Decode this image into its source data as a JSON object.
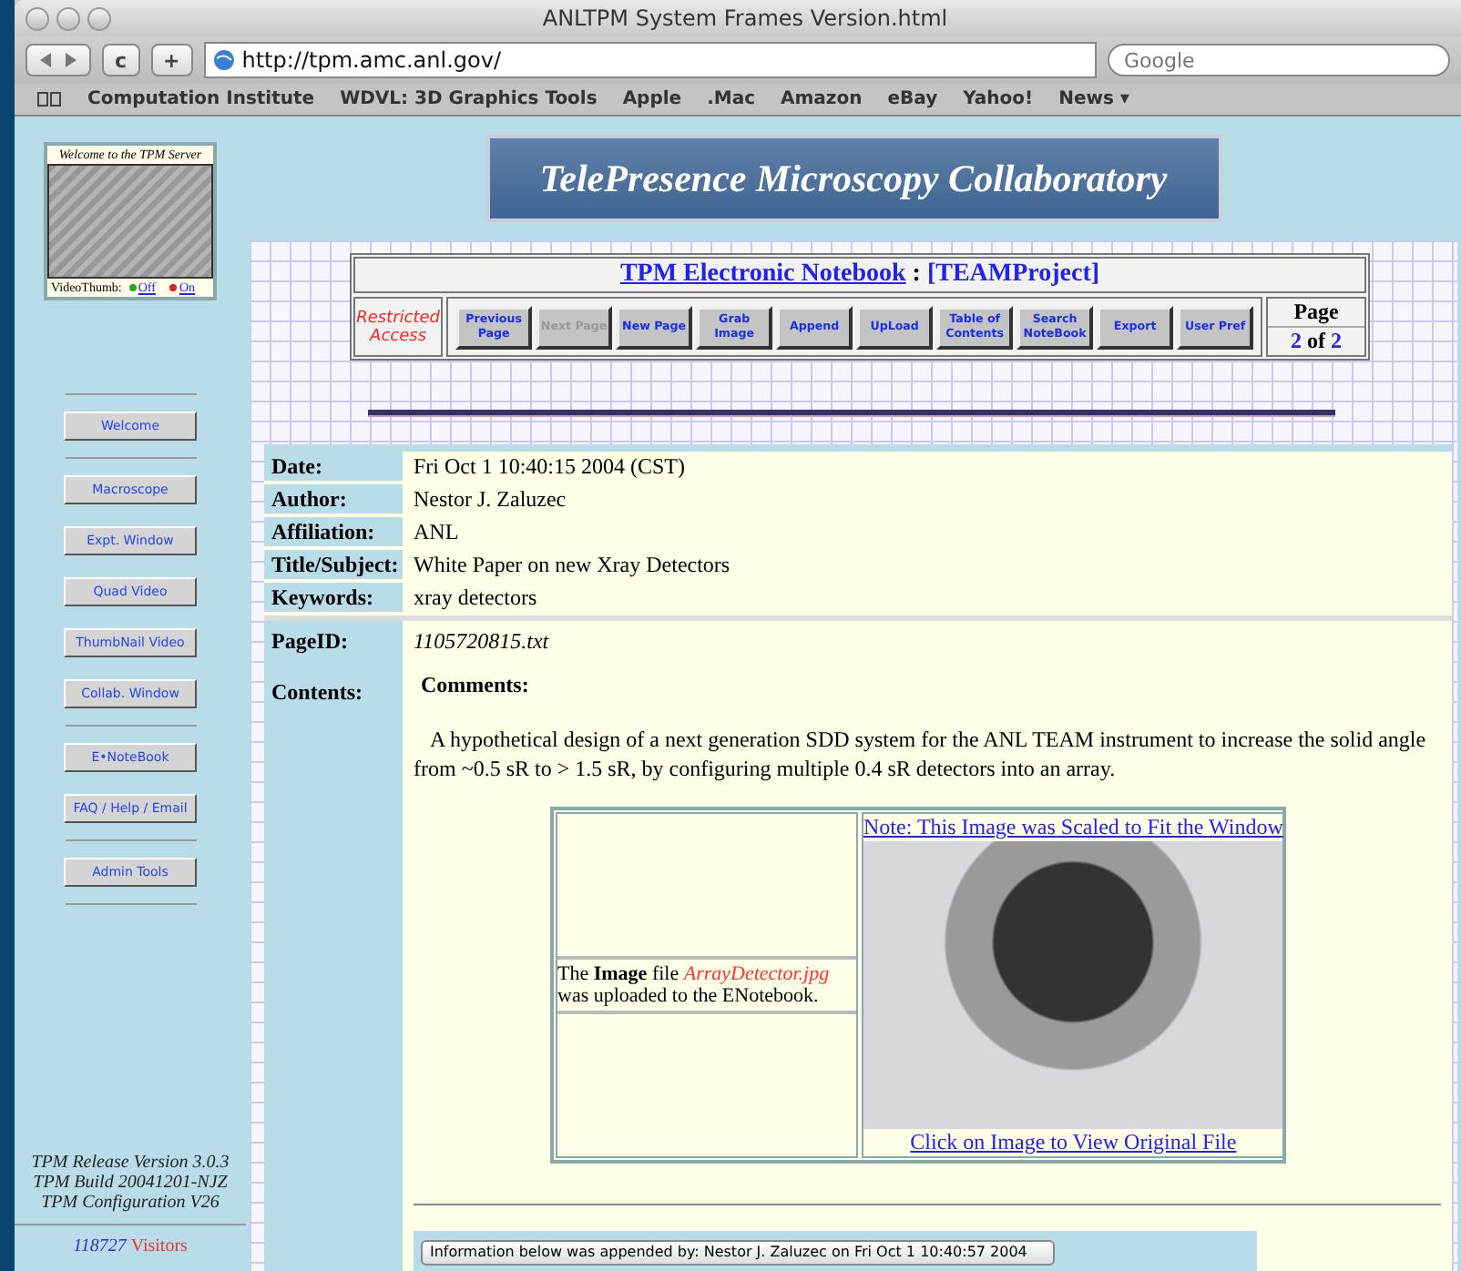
{
  "window": {
    "title": "ANLTPM System Frames Version.html"
  },
  "toolbar": {
    "reload": "c",
    "add": "+",
    "url": "http://tpm.amc.anl.gov/",
    "search": {
      "placeholder": "Google"
    }
  },
  "bookmarks": [
    "Computation Institute",
    "WDVL: 3D Graphics Tools",
    "Apple",
    ".Mac",
    "Amazon",
    "eBay",
    "Yahoo!",
    "News ▾"
  ],
  "sidebar": {
    "welcome_caption": "Welcome to the TPM Server",
    "video_thumb": {
      "label": "VideoThumb:",
      "options": [
        {
          "label": "Off",
          "color": "#22aa22"
        },
        {
          "label": "On",
          "color": "#dd2222"
        }
      ]
    },
    "items": [
      {
        "label": "Welcome",
        "rule_after": true
      },
      {
        "label": "Macroscope",
        "rule_after": false
      },
      {
        "label": "Expt. Window",
        "rule_after": false
      },
      {
        "label": "Quad Video",
        "rule_after": false
      },
      {
        "label": "ThumbNail Video",
        "rule_after": false
      },
      {
        "label": "Collab. Window",
        "rule_after": true
      },
      {
        "label": "E•NoteBook",
        "rule_after": false
      },
      {
        "label": "FAQ / Help / Email",
        "rule_after": true
      },
      {
        "label": "Admin Tools",
        "rule_after": true
      }
    ],
    "footer": [
      "TPM Release Version 3.0.3",
      "TPM Build 20041201-NJZ",
      "TPM Configuration V26"
    ],
    "visitors": {
      "count": "118727",
      "label": "Visitors"
    }
  },
  "banner": {
    "title": "TelePresence Microscopy Collaboratory"
  },
  "notebook": {
    "title": "TPM Electronic Notebook",
    "separator": ":",
    "project": "[TEAMProject]",
    "access": "Restricted Access",
    "buttons": [
      {
        "label": "Previous Page",
        "disabled": false
      },
      {
        "label": "Next Page",
        "disabled": true
      },
      {
        "label": "New Page",
        "disabled": false
      },
      {
        "label": "Grab Image",
        "disabled": false
      },
      {
        "label": "Append",
        "disabled": false
      },
      {
        "label": "UpLoad",
        "disabled": false
      },
      {
        "label": "Table of Contents",
        "disabled": false
      },
      {
        "label": "Search NoteBook",
        "disabled": false
      },
      {
        "label": "Export",
        "disabled": false
      },
      {
        "label": "User Pref",
        "disabled": false
      }
    ],
    "page": {
      "label": "Page",
      "current": "2",
      "of": "of",
      "total": "2"
    }
  },
  "entry": {
    "fields": [
      {
        "label": "Date:",
        "value": "Fri Oct 1 10:40:15 2004 (CST)"
      },
      {
        "label": "Author:",
        "value": "Nestor J. Zaluzec"
      },
      {
        "label": "Affiliation:",
        "value": "ANL"
      },
      {
        "label": "Title/Subject:",
        "value": "White Paper on new Xray Detectors"
      },
      {
        "label": "Keywords:",
        "value": "xray detectors"
      }
    ],
    "page_id": {
      "label": "PageID:",
      "value": "1105720815.txt"
    },
    "contents_label": "Contents:",
    "comments_heading": "Comments:",
    "comments": "A hypothetical design of a next generation SDD system for the ANL TEAM instrument to increase the solid angle from ~0.5 sR to > 1.5 sR, by configuring multiple 0.4 sR detectors into an array.",
    "upload": {
      "before": "The **Image** file",
      "file": "ArrayDetector.jpg",
      "after": "was uploaded to the ENotebook."
    },
    "image_note": "Note: This Image was Scaled to Fit the Window",
    "image_link": "Click on Image to View Original File",
    "appended": "Information below was appended by: Nestor J. Zaluzec on Fri Oct 1 10:40:57 2004"
  }
}
